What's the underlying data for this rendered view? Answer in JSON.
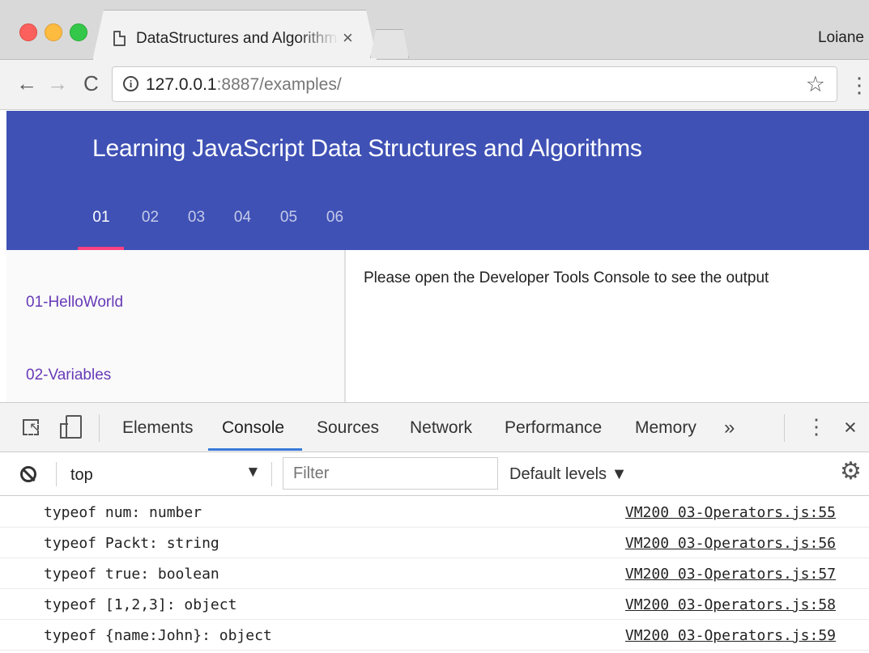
{
  "browser": {
    "tab_title": "DataStructures and Algorithms",
    "tab_close": "×",
    "profile_name": "Loiane",
    "url_host": "127.0.0.1",
    "url_rest": ":8887/examples/",
    "info_glyph": "i",
    "back_glyph": "←",
    "forward_glyph": "→",
    "reload_glyph": "C",
    "star_glyph": "☆",
    "menu_glyph": "⋮"
  },
  "app": {
    "title": "Learning JavaScript Data Structures and Algorithms",
    "header_color": "#3f51b5",
    "chapter_tabs": [
      "01",
      "02",
      "03",
      "04",
      "05",
      "06"
    ],
    "active_chapter": "01",
    "examples": [
      "01-HelloWorld",
      "02-Variables"
    ],
    "content_message": "Please open the Developer Tools Console to see the output"
  },
  "devtools": {
    "tabs": [
      "Elements",
      "Console",
      "Sources",
      "Network",
      "Performance",
      "Memory"
    ],
    "active_tab": "Console",
    "more_glyph": "»",
    "menu_glyph": "⋮",
    "close_glyph": "×",
    "context": "top",
    "context_arrow": "▼",
    "filter_placeholder": "Filter",
    "levels_label": "Default levels ▼",
    "gear_glyph": "⚙",
    "console_rows": [
      {
        "message": "typeof num: number",
        "source": "VM200 03-Operators.js:55"
      },
      {
        "message": "typeof Packt: string",
        "source": "VM200 03-Operators.js:56"
      },
      {
        "message": "typeof true: boolean",
        "source": "VM200 03-Operators.js:57"
      },
      {
        "message": "typeof [1,2,3]: object",
        "source": "VM200 03-Operators.js:58"
      },
      {
        "message": "typeof {name:John}: object",
        "source": "VM200 03-Operators.js:59"
      }
    ]
  }
}
